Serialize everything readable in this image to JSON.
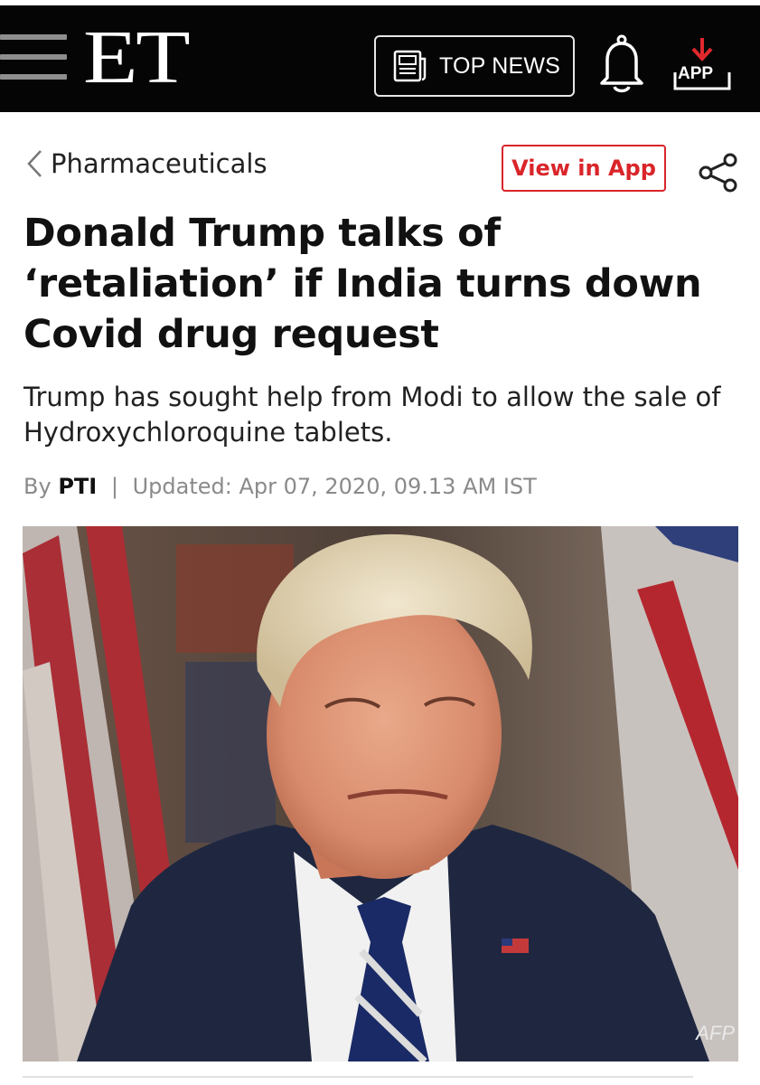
{
  "header": {
    "logo": "ET",
    "top_news_label": "TOP NEWS",
    "app_label": "APP",
    "icons": [
      "menu-icon",
      "newspaper-icon",
      "bell-icon",
      "download-app-icon"
    ]
  },
  "article": {
    "section": "Pharmaceuticals",
    "view_in_app": "View in App",
    "headline": "Donald Trump talks of ‘retaliation’ if India turns down Covid drug request",
    "synopsis": "Trump has sought help from Modi to allow the sale of Hydroxychloroquine tablets.",
    "byline_prefix": "By",
    "author": "PTI",
    "separator": "|",
    "updated": "Updated: Apr 07, 2020, 09.13 AM IST",
    "photo_credit": "AFP"
  },
  "colors": {
    "header_bg": "#050505",
    "accent_red": "#d9252a"
  }
}
